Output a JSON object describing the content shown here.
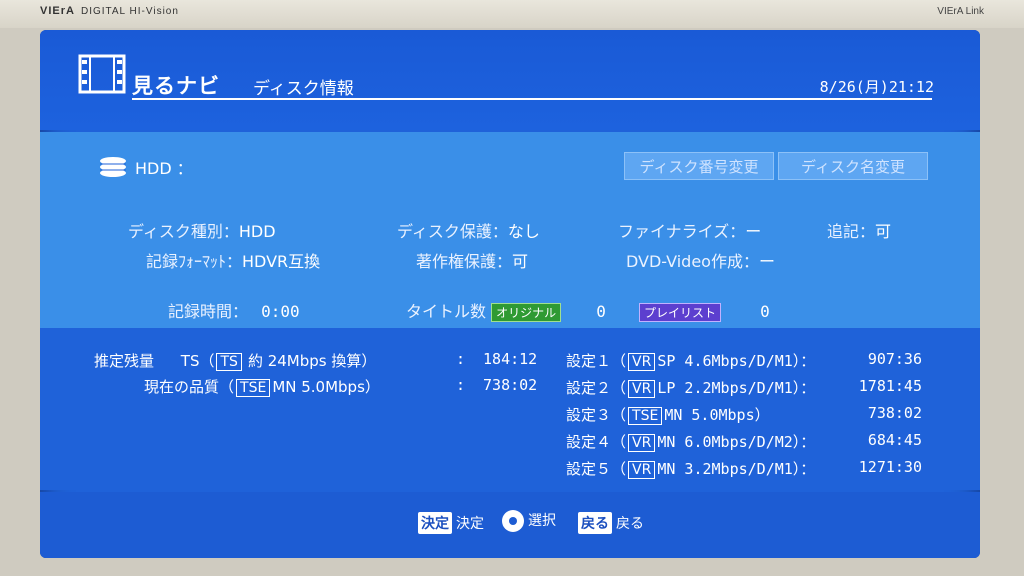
{
  "bezel": {
    "brand_left": "VIErA",
    "brand_left_sub": "DIGITAL HI-Vision",
    "brand_right": "VIErA Link"
  },
  "header": {
    "title": "見るナビ",
    "subtitle": "ディスク情報",
    "clock": "8/26(月)21:12"
  },
  "disc": {
    "drive_label": "HDD ：",
    "btn_change_number": "ディスク番号変更",
    "btn_change_name": "ディスク名変更",
    "disk_type_label": "ディスク種別：",
    "disk_type_value": "HDD",
    "protect_label": "ディスク保護：",
    "protect_value": "なし",
    "finalize_label": "ファイナライズ：",
    "finalize_value": "ー",
    "append_label": "追記：",
    "append_value": "可",
    "format_label": "記録ﾌｫｰﾏｯﾄ：",
    "format_value": "HDVR互換",
    "copyright_label": "著作権保護：",
    "copyright_value": "可",
    "dvdvideo_label": "DVD-Video作成：",
    "dvdvideo_value": "ー",
    "rec_time_label": "記録時間：",
    "rec_time_value": "0:00",
    "titles_label": "タイトル数",
    "tag_original": "オリジナル",
    "original_count": "0",
    "tag_playlist": "プレイリスト",
    "playlist_count": "0"
  },
  "remaining": {
    "est_label": "推定残量",
    "ts_text": "TS（",
    "ts_box": "TS",
    "ts_rate": "約 24Mbps 換算）",
    "ts_time": "184:12",
    "current_label": "現在の品質（",
    "current_box": "TSE",
    "current_rate": "MN 5.0Mbps）",
    "current_time": "738:02",
    "settings": [
      {
        "label": "設定１（",
        "box": "VR",
        "rate": "SP 4.6Mbps/",
        "mode": "D/M1）：",
        "time": "907:36"
      },
      {
        "label": "設定２（",
        "box": "VR",
        "rate": "LP 2.2Mbps/",
        "mode": "D/M1）：",
        "time": "1781:45"
      },
      {
        "label": "設定３（",
        "box": "TSE",
        "rate": "MN 5.0Mbps）",
        "mode": "",
        "time": "738:02"
      },
      {
        "label": "設定４（",
        "box": "VR",
        "rate": "MN 6.0Mbps/",
        "mode": "D/M2）：",
        "time": "684:45"
      },
      {
        "label": "設定５（",
        "box": "VR",
        "rate": "MN 3.2Mbps/",
        "mode": "D/M1）：",
        "time": "1271:30"
      }
    ]
  },
  "footer": {
    "ok_key": "決定",
    "ok_label": "決定",
    "select_label": "選択",
    "back_key": "戻る",
    "back_label": "戻る"
  }
}
